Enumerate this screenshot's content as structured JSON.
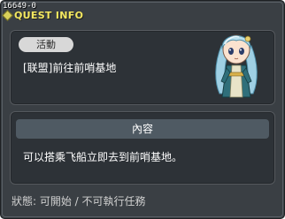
{
  "window": {
    "quest_id": "16649-0",
    "title": "QUEST INFO"
  },
  "quest": {
    "tag": "活動",
    "name": "[联盟]前往前哨基地",
    "npc_icon": "npc-portrait-icon"
  },
  "content": {
    "header": "內容",
    "text": "可以搭乘飞船立即去到前哨基地。"
  },
  "status": {
    "text": "狀態: 可開始 / 不可執行任務"
  },
  "colors": {
    "window_bg": "#3a3f44",
    "panel_bg": "#2d3237",
    "title_color": "#f4e860",
    "header_bg": "#4f5a63",
    "tag_bg": "#d8d8d8"
  }
}
